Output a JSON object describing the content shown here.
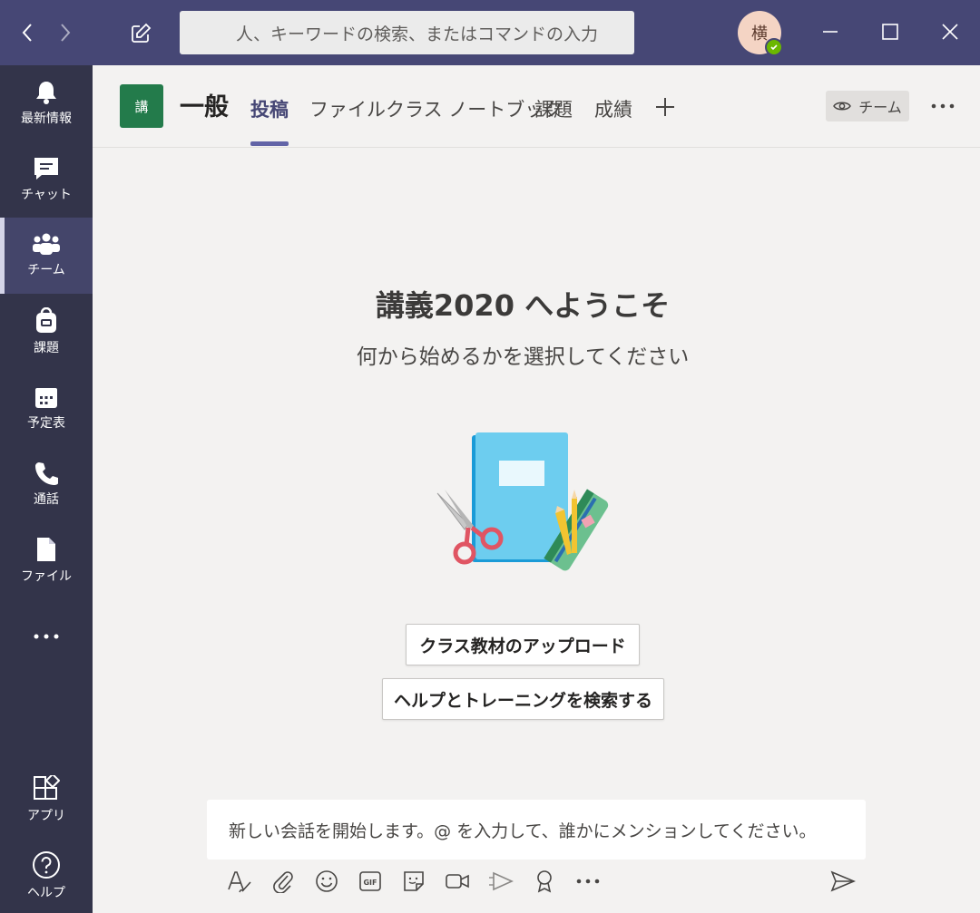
{
  "search": {
    "placeholder": "人、キーワードの検索、またはコマンドの入力"
  },
  "user": {
    "avatar_initial": "横"
  },
  "rail": {
    "items": [
      {
        "label": "最新情報",
        "icon": "bell-icon"
      },
      {
        "label": "チャット",
        "icon": "chat-icon"
      },
      {
        "label": "チーム",
        "icon": "teams-icon",
        "active": true
      },
      {
        "label": "課題",
        "icon": "backpack-icon"
      },
      {
        "label": "予定表",
        "icon": "calendar-icon"
      },
      {
        "label": "通話",
        "icon": "phone-icon"
      },
      {
        "label": "ファイル",
        "icon": "file-icon"
      }
    ],
    "apps_label": "アプリ",
    "help_label": "ヘルプ"
  },
  "channel": {
    "team_tile": "講",
    "name": "一般",
    "tabs": [
      "投稿",
      "ファイル",
      "クラス ノートブック",
      "課題",
      "成績"
    ],
    "team_button": "チーム"
  },
  "welcome": {
    "title": "講義2020 へようこそ",
    "subtitle": "何から始めるかを選択してください",
    "upload_button": "クラス教材のアップロード",
    "help_button": "ヘルプとトレーニングを検索する"
  },
  "compose": {
    "placeholder": "新しい会話を開始します。@ を入力して、誰かにメンションしてください。"
  },
  "colors": {
    "titlebar": "#464775",
    "rail": "#33344a",
    "accent": "#6264a7",
    "team_tile": "#237b4b",
    "presence": "#6bb700"
  }
}
